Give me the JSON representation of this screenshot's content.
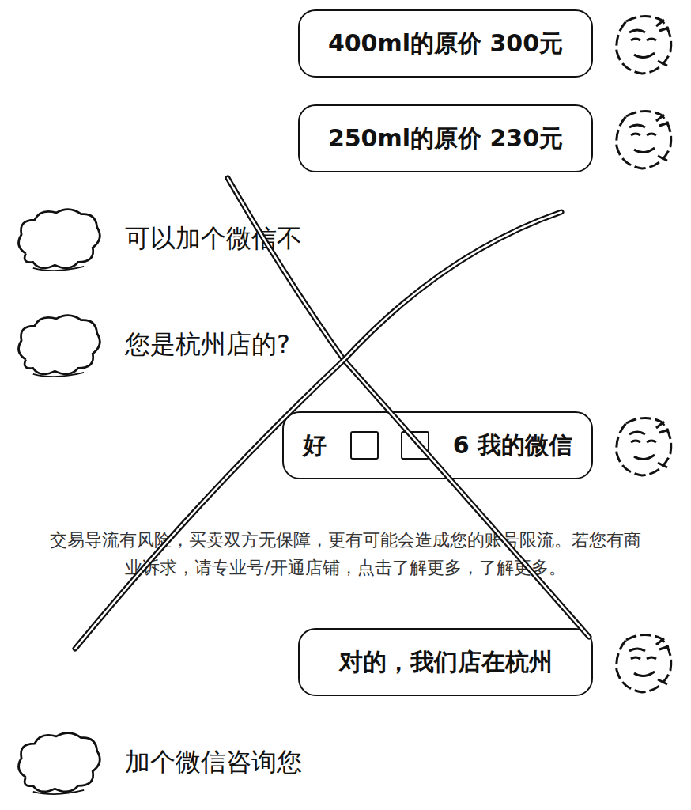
{
  "messages": [
    {
      "side": "right",
      "kind": "bubble",
      "text": "400ml的原价 300元"
    },
    {
      "side": "right",
      "kind": "bubble",
      "text": "250ml的原价 230元"
    },
    {
      "side": "left",
      "kind": "plain",
      "text": "可以加个微信不"
    },
    {
      "side": "left",
      "kind": "plain",
      "text": "您是杭州店的?"
    },
    {
      "side": "right",
      "kind": "redacted",
      "before": "好",
      "after": "6 我的微信"
    },
    {
      "side": "center",
      "kind": "notice",
      "text": "交易导流有风险，买卖双方无保障，更有可能会造成您的账号限流。若您有商业诉求，请专业号/开通店铺，点击了解更多，了解更多。"
    },
    {
      "side": "right",
      "kind": "bubble",
      "text": "对的，我们店在杭州"
    },
    {
      "side": "left",
      "kind": "plain",
      "text": "加个微信咨询您"
    }
  ]
}
